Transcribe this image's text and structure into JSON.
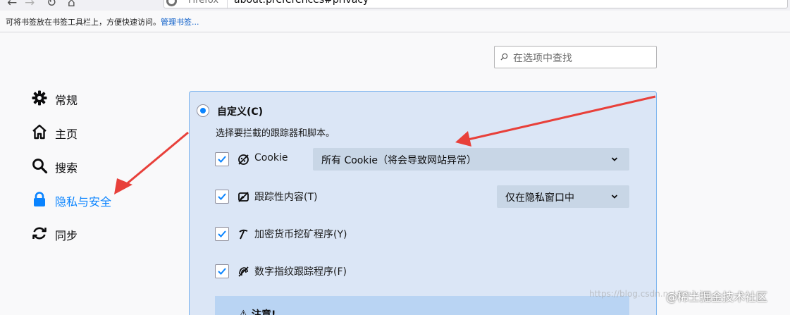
{
  "browser": {
    "url_identity": "Firefox",
    "url": "about:preferences#privacy",
    "bookmarks_hint": "可将书签放在书签工具栏上，方便快速访问。",
    "bookmarks_manage": "管理书签..."
  },
  "search": {
    "placeholder": "在选项中查找"
  },
  "sidebar": {
    "items": [
      {
        "label": "常规",
        "icon": "gear-icon"
      },
      {
        "label": "主页",
        "icon": "home-icon"
      },
      {
        "label": "搜索",
        "icon": "search-icon"
      },
      {
        "label": "隐私与安全",
        "icon": "lock-icon",
        "active": true
      },
      {
        "label": "同步",
        "icon": "sync-icon"
      }
    ]
  },
  "custom": {
    "radio_label": "自定义(C)",
    "description": "选择要拦截的跟踪器和脚本。",
    "options": [
      {
        "label": "Cookie",
        "checked": true,
        "icon": "cookie-icon",
        "dropdown": "所有 Cookie（将会导致网站异常）"
      },
      {
        "label": "跟踪性内容(T)",
        "checked": true,
        "icon": "tracking-content-icon",
        "dropdown": "仅在隐私窗口中"
      },
      {
        "label": "加密货币挖矿程序(Y)",
        "checked": true,
        "icon": "cryptominer-icon"
      },
      {
        "label": "数字指纹跟踪程序(F)",
        "checked": true,
        "icon": "fingerprint-icon"
      }
    ],
    "note_icon": "warning-icon",
    "note_label": "注意!"
  },
  "watermark": "https://blog.csdn.net/weixin_",
  "brand": "@稀土掘金技术社区",
  "colors": {
    "accent": "#0a84ff",
    "arrow": "#e8403a",
    "panel": "#dbe6f6"
  }
}
